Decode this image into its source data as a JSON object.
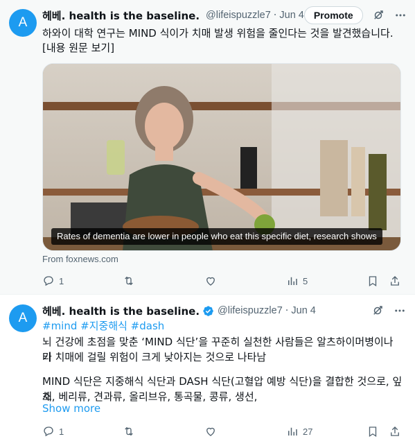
{
  "tweets": [
    {
      "avatar_letter": "A",
      "display_name": "헤베. health is the baseline.",
      "handle": "@lifeispuzzle7",
      "separator": "·",
      "date": "Jun 4",
      "promote_label": "Promote",
      "text_line1": "하와이 대학 연구는 MIND 식이가 치매 발생 위험을 줄인다는 것을 발견했습니다.",
      "text_line2": "[내용 원문 보기]",
      "card_caption": "Rates of dementia are lower in people who eat this specific diet, research shows",
      "card_source": "From foxnews.com",
      "replies": "1",
      "views": "5"
    },
    {
      "avatar_letter": "A",
      "display_name": "헤베. health is the baseline.",
      "handle": "@lifeispuzzle7",
      "separator": "·",
      "date": "Jun 4",
      "hashtags": "#mind #지중해식 #dash",
      "body_line1": "뇌 건강에 초점을 맞춘 ‘MIND 식단’을 꾸준히 실천한 사람들은 알츠하이머병이나 기",
      "body_line2": "타 치매에 걸릴 위험이 크게 낮아지는 것으로 나타남",
      "body_line3": "MIND 식단은 지중해식 식단과 DASH 식단(고혈압 예방 식단)을 결합한 것으로, 잎채",
      "body_line4": "소, 베리류, 견과류, 올리브유, 통곡물, 콩류, 생선,",
      "show_more": "Show more",
      "replies": "1",
      "views": "27"
    }
  ],
  "colors": {
    "accent": "#1d9bf0",
    "muted": "#536471",
    "text": "#0f1419",
    "highlight_bg": "#f7f9f9"
  },
  "icons": [
    "verified-badge-icon",
    "grok-icon",
    "more-icon",
    "reply-icon",
    "retweet-icon",
    "like-icon",
    "views-icon",
    "bookmark-icon",
    "share-icon"
  ]
}
